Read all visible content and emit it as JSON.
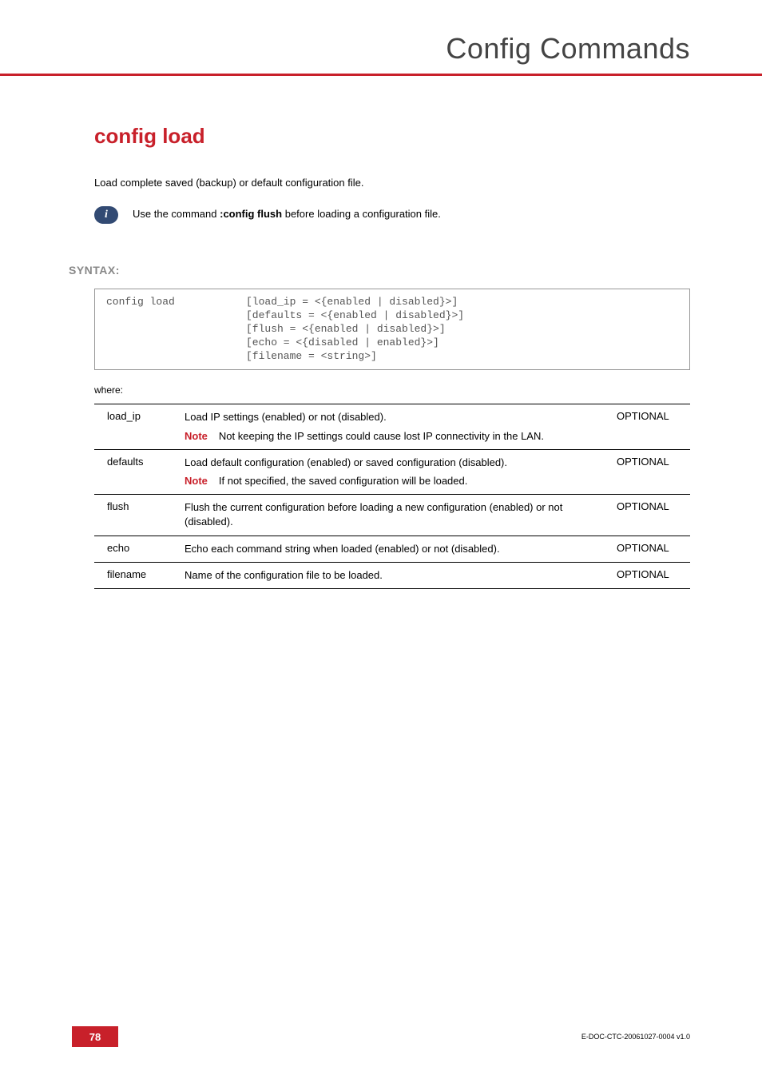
{
  "header": {
    "title": "Config Commands"
  },
  "command": {
    "title": "config load",
    "description": "Load complete saved (backup) or default configuration file."
  },
  "info": {
    "pre": "Use the command ",
    "cmd": ":config flush",
    "post": " before loading a configuration file."
  },
  "syntax": {
    "label": "SYNTAX:",
    "cmd": "config load",
    "lines": [
      "[load_ip = <{enabled | disabled}>]",
      "[defaults = <{enabled | disabled}>]",
      "[flush = <{enabled | disabled}>]",
      "[echo = <{disabled | enabled}>]",
      "[filename = <string>]"
    ]
  },
  "where_label": "where:",
  "note_label": "Note",
  "params": [
    {
      "name": "load_ip",
      "desc": "Load IP settings (enabled) or not (disabled).",
      "note": "Not keeping the IP settings could cause lost IP connectivity in the LAN.",
      "opt": "OPTIONAL"
    },
    {
      "name": "defaults",
      "desc": "Load default configuration (enabled) or saved configuration (disabled).",
      "note": "If not specified, the saved configuration will be loaded.",
      "opt": "OPTIONAL"
    },
    {
      "name": "flush",
      "desc": "Flush the current configuration before loading a new configuration (enabled) or not (disabled).",
      "note": null,
      "opt": "OPTIONAL"
    },
    {
      "name": "echo",
      "desc": "Echo each command string when loaded (enabled) or not (disabled).",
      "note": null,
      "opt": "OPTIONAL"
    },
    {
      "name": "filename",
      "desc": "Name of the configuration file to be loaded.",
      "note": null,
      "opt": "OPTIONAL"
    }
  ],
  "footer": {
    "page": "78",
    "docid": "E-DOC-CTC-20061027-0004 v1.0"
  }
}
